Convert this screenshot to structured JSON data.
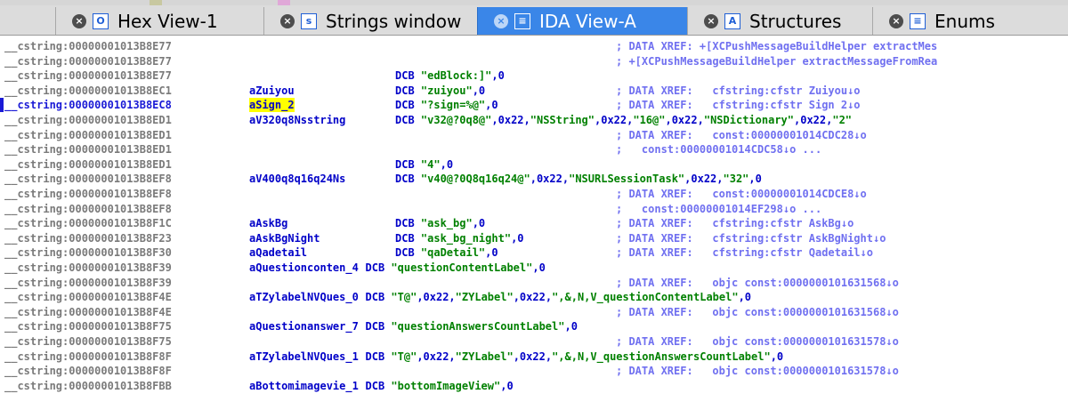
{
  "tabs": [
    {
      "label": "Hex View-1",
      "icon": "hex-view-icon",
      "glyph": "O",
      "active": false
    },
    {
      "label": "Strings window",
      "icon": "strings-icon",
      "glyph": "s",
      "active": false
    },
    {
      "label": "IDA View-A",
      "icon": "ida-view-icon",
      "glyph": "≡",
      "active": true
    },
    {
      "label": "Structures",
      "icon": "structures-icon",
      "glyph": "A",
      "active": false
    },
    {
      "label": "Enums",
      "icon": "enums-icon",
      "glyph": "≡",
      "active": false
    }
  ],
  "close_glyph": "×",
  "lines": [
    {
      "addr": "__cstring:00000001013B8E77",
      "label": "",
      "ins": "",
      "cm": "; DATA XREF: +[XCPushMessageBuildHelper extractMes",
      "cm2": ""
    },
    {
      "addr": "__cstring:00000001013B8E77",
      "label": "",
      "ins": "",
      "cm": "; +[XCPushMessageBuildHelper extractMessageFromRea",
      "cm2": ""
    },
    {
      "addr": "__cstring:00000001013B8E77",
      "label": "",
      "ins": "DCB \"edBlock:]\",0",
      "cm": "",
      "cm2": ""
    },
    {
      "addr": "__cstring:00000001013B8EC1",
      "label": "aZuiyou",
      "ins": "DCB \"zuiyou\",0",
      "cm": "; DATA XREF:   cfstring:cfstr Zuiyou↓o",
      "cm2": ""
    },
    {
      "addr": "__cstring:00000001013B8EC8",
      "label": "aSign_2",
      "ins": "DCB \"?sign=%@\",0",
      "cm": "; DATA XREF:   cfstring:cfstr Sign 2↓o",
      "cm2": "",
      "current": true
    },
    {
      "addr": "__cstring:00000001013B8ED1",
      "label": "aV320q8Nsstring",
      "ins": "DCB \"v32@?0q8@\",0x22,\"NSString\",0x22,\"16@\",0x22,\"NSDictionary\",0x22,\"2\"",
      "cm": "",
      "cm2": ""
    },
    {
      "addr": "__cstring:00000001013B8ED1",
      "label": "",
      "ins": "",
      "cm": "; DATA XREF:   const:00000001014CDC28↓o",
      "cm2": ""
    },
    {
      "addr": "__cstring:00000001013B8ED1",
      "label": "",
      "ins": "",
      "cm": ";   const:00000001014CDC58↓o ...",
      "cm2": ""
    },
    {
      "addr": "__cstring:00000001013B8ED1",
      "label": "",
      "ins": "DCB \"4\",0",
      "cm": "",
      "cm2": ""
    },
    {
      "addr": "__cstring:00000001013B8EF8",
      "label": "aV400q8q16q24Ns",
      "ins": "DCB \"v40@?0Q8q16q24@\",0x22,\"NSURLSessionTask\",0x22,\"32\",0",
      "cm": "",
      "cm2": ""
    },
    {
      "addr": "__cstring:00000001013B8EF8",
      "label": "",
      "ins": "",
      "cm": "; DATA XREF:   const:00000001014CDCE8↓o",
      "cm2": ""
    },
    {
      "addr": "__cstring:00000001013B8EF8",
      "label": "",
      "ins": "",
      "cm": ";   const:00000001014EF298↓o ...",
      "cm2": ""
    },
    {
      "addr": "__cstring:00000001013B8F1C",
      "label": "aAskBg",
      "ins": "DCB \"ask_bg\",0",
      "cm": "; DATA XREF:   cfstring:cfstr AskBg↓o",
      "cm2": ""
    },
    {
      "addr": "__cstring:00000001013B8F23",
      "label": "aAskBgNight",
      "ins": "DCB \"ask_bg_night\",0",
      "cm": "; DATA XREF:   cfstring:cfstr AskBgNight↓o",
      "cm2": ""
    },
    {
      "addr": "__cstring:00000001013B8F30",
      "label": "aQadetail",
      "ins": "DCB \"qaDetail\",0",
      "cm": "; DATA XREF:   cfstring:cfstr Qadetail↓o",
      "cm2": ""
    },
    {
      "addr": "__cstring:00000001013B8F39",
      "label": "aQuestionconten_4",
      "ins": "DCB \"questionContentLabel\",0",
      "cm": "",
      "cm2": ""
    },
    {
      "addr": "__cstring:00000001013B8F39",
      "label": "",
      "ins": "",
      "cm": "; DATA XREF:   objc const:0000000101631568↓o",
      "cm2": ""
    },
    {
      "addr": "__cstring:00000001013B8F4E",
      "label": "aTZylabelNVQues_0",
      "ins": "DCB \"T@\",0x22,\"ZYLabel\",0x22,\",&,N,V_questionContentLabel\",0",
      "cm": "",
      "cm2": ""
    },
    {
      "addr": "__cstring:00000001013B8F4E",
      "label": "",
      "ins": "",
      "cm": "; DATA XREF:   objc const:0000000101631568↓o",
      "cm2": ""
    },
    {
      "addr": "__cstring:00000001013B8F75",
      "label": "aQuestionanswer_7",
      "ins": "DCB \"questionAnswersCountLabel\",0",
      "cm": "",
      "cm2": ""
    },
    {
      "addr": "__cstring:00000001013B8F75",
      "label": "",
      "ins": "",
      "cm": "; DATA XREF:   objc const:0000000101631578↓o",
      "cm2": ""
    },
    {
      "addr": "__cstring:00000001013B8F8F",
      "label": "aTZylabelNVQues_1",
      "ins": "DCB \"T@\",0x22,\"ZYLabel\",0x22,\",&,N,V_questionAnswersCountLabel\",0",
      "cm": "",
      "cm2": ""
    },
    {
      "addr": "__cstring:00000001013B8F8F",
      "label": "",
      "ins": "",
      "cm": "; DATA XREF:   objc const:0000000101631578↓o",
      "cm2": ""
    },
    {
      "addr": "__cstring:00000001013B8FBB",
      "label": "aBottomimagevie_1",
      "ins": "DCB \"bottomImageView\",0",
      "cm": "",
      "cm2": ""
    }
  ]
}
